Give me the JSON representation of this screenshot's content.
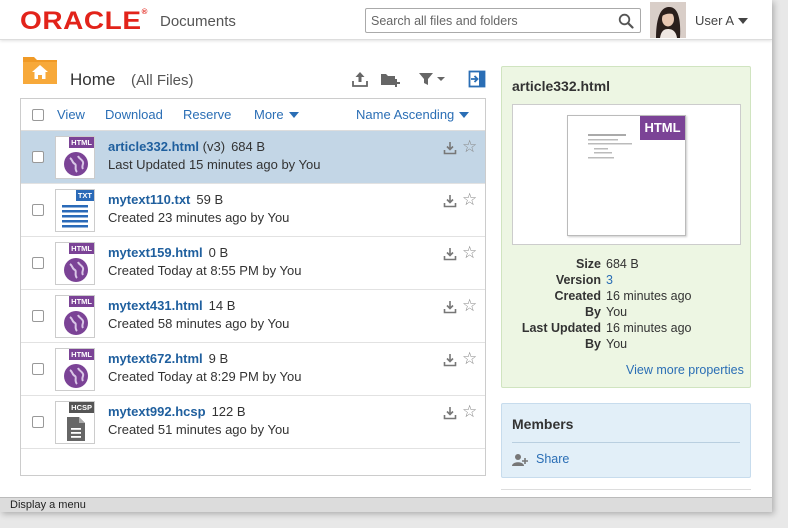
{
  "header": {
    "logo_text": "ORACLE",
    "logo_mark": "®",
    "app_name": "Documents",
    "search_placeholder": "Search all files and folders",
    "search_icon": "search-icon",
    "user_name": "User A"
  },
  "folder": {
    "title": "Home",
    "subtitle": "(All Files)",
    "toolbar_icons": [
      "upload-icon",
      "new-folder-icon",
      "filter-icon",
      "open-panel-icon"
    ]
  },
  "file_toolbar": {
    "view_label": "View",
    "download_label": "Download",
    "reserve_label": "Reserve",
    "more_label": "More",
    "sort_label": "Name Ascending"
  },
  "files": [
    {
      "name": "article332.html",
      "version": "(v3)",
      "size": "684 B",
      "status": "Last Updated 15 minutes ago by You",
      "type": "HTML",
      "selected": true
    },
    {
      "name": "mytext110.txt",
      "version": "",
      "size": "59 B",
      "status": "Created 23 minutes ago by You",
      "type": "TXT",
      "selected": false
    },
    {
      "name": "mytext159.html",
      "version": "",
      "size": "0 B",
      "status": "Created Today at 8:55 PM by You",
      "type": "HTML",
      "selected": false
    },
    {
      "name": "mytext431.html",
      "version": "",
      "size": "14 B",
      "status": "Created 58 minutes ago by You",
      "type": "HTML",
      "selected": false
    },
    {
      "name": "mytext672.html",
      "version": "",
      "size": "9 B",
      "status": "Created Today at 8:29 PM by You",
      "type": "HTML",
      "selected": false
    },
    {
      "name": "mytext992.hcsp",
      "version": "",
      "size": "122 B",
      "status": "Created 51 minutes ago by You",
      "type": "HCSP",
      "selected": false
    }
  ],
  "properties": {
    "title": "article332.html",
    "preview_badge": "HTML",
    "rows": [
      {
        "label": "Size",
        "value": "684 B",
        "link": false
      },
      {
        "label": "Version",
        "value": "3",
        "link": true
      },
      {
        "label": "Created",
        "value": "16 minutes ago",
        "link": false
      },
      {
        "label": "By",
        "value": "You",
        "link": false
      },
      {
        "label": "Last Updated",
        "value": "16 minutes ago",
        "link": false
      },
      {
        "label": "By",
        "value": "You",
        "link": false
      }
    ],
    "view_more": "View more properties"
  },
  "members": {
    "title": "Members",
    "share_label": "Share"
  },
  "status_bar": {
    "text": "Display a menu"
  },
  "colors": {
    "oracle_red": "#e2231a",
    "link_blue": "#2a6eb5",
    "selected_row": "#c3d6e6",
    "html_badge": "#7b4396",
    "txt_badge": "#2a6ab8",
    "hcsp_badge": "#555555",
    "properties_bg": "#edf6e3",
    "members_bg": "#e2eff8"
  }
}
